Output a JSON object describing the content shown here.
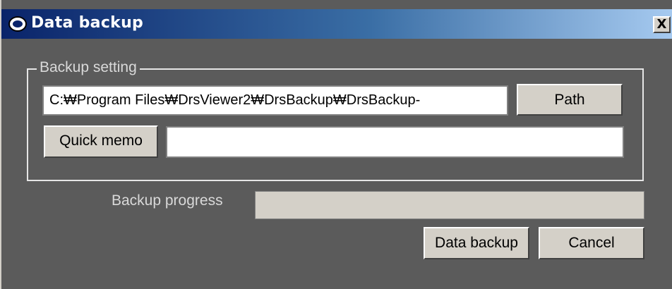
{
  "window": {
    "title": "Data backup",
    "close_label": "X"
  },
  "backup_setting": {
    "legend": "Backup setting",
    "path_value": "C:₩Program Files₩DrsViewer2₩DrsBackup₩DrsBackup-",
    "path_button": "Path",
    "quick_memo_button": "Quick memo",
    "quick_memo_value": ""
  },
  "progress": {
    "label": "Backup progress",
    "value_percent": 0
  },
  "actions": {
    "data_backup": "Data backup",
    "cancel": "Cancel"
  },
  "colors": {
    "title_start": "#0a246a",
    "title_end": "#a6caf0",
    "panel": "#5b5b5b",
    "button_face": "#d4d0c8"
  },
  "icons": {
    "title_icon": "app-logo-icon",
    "close_icon": "close-icon"
  }
}
